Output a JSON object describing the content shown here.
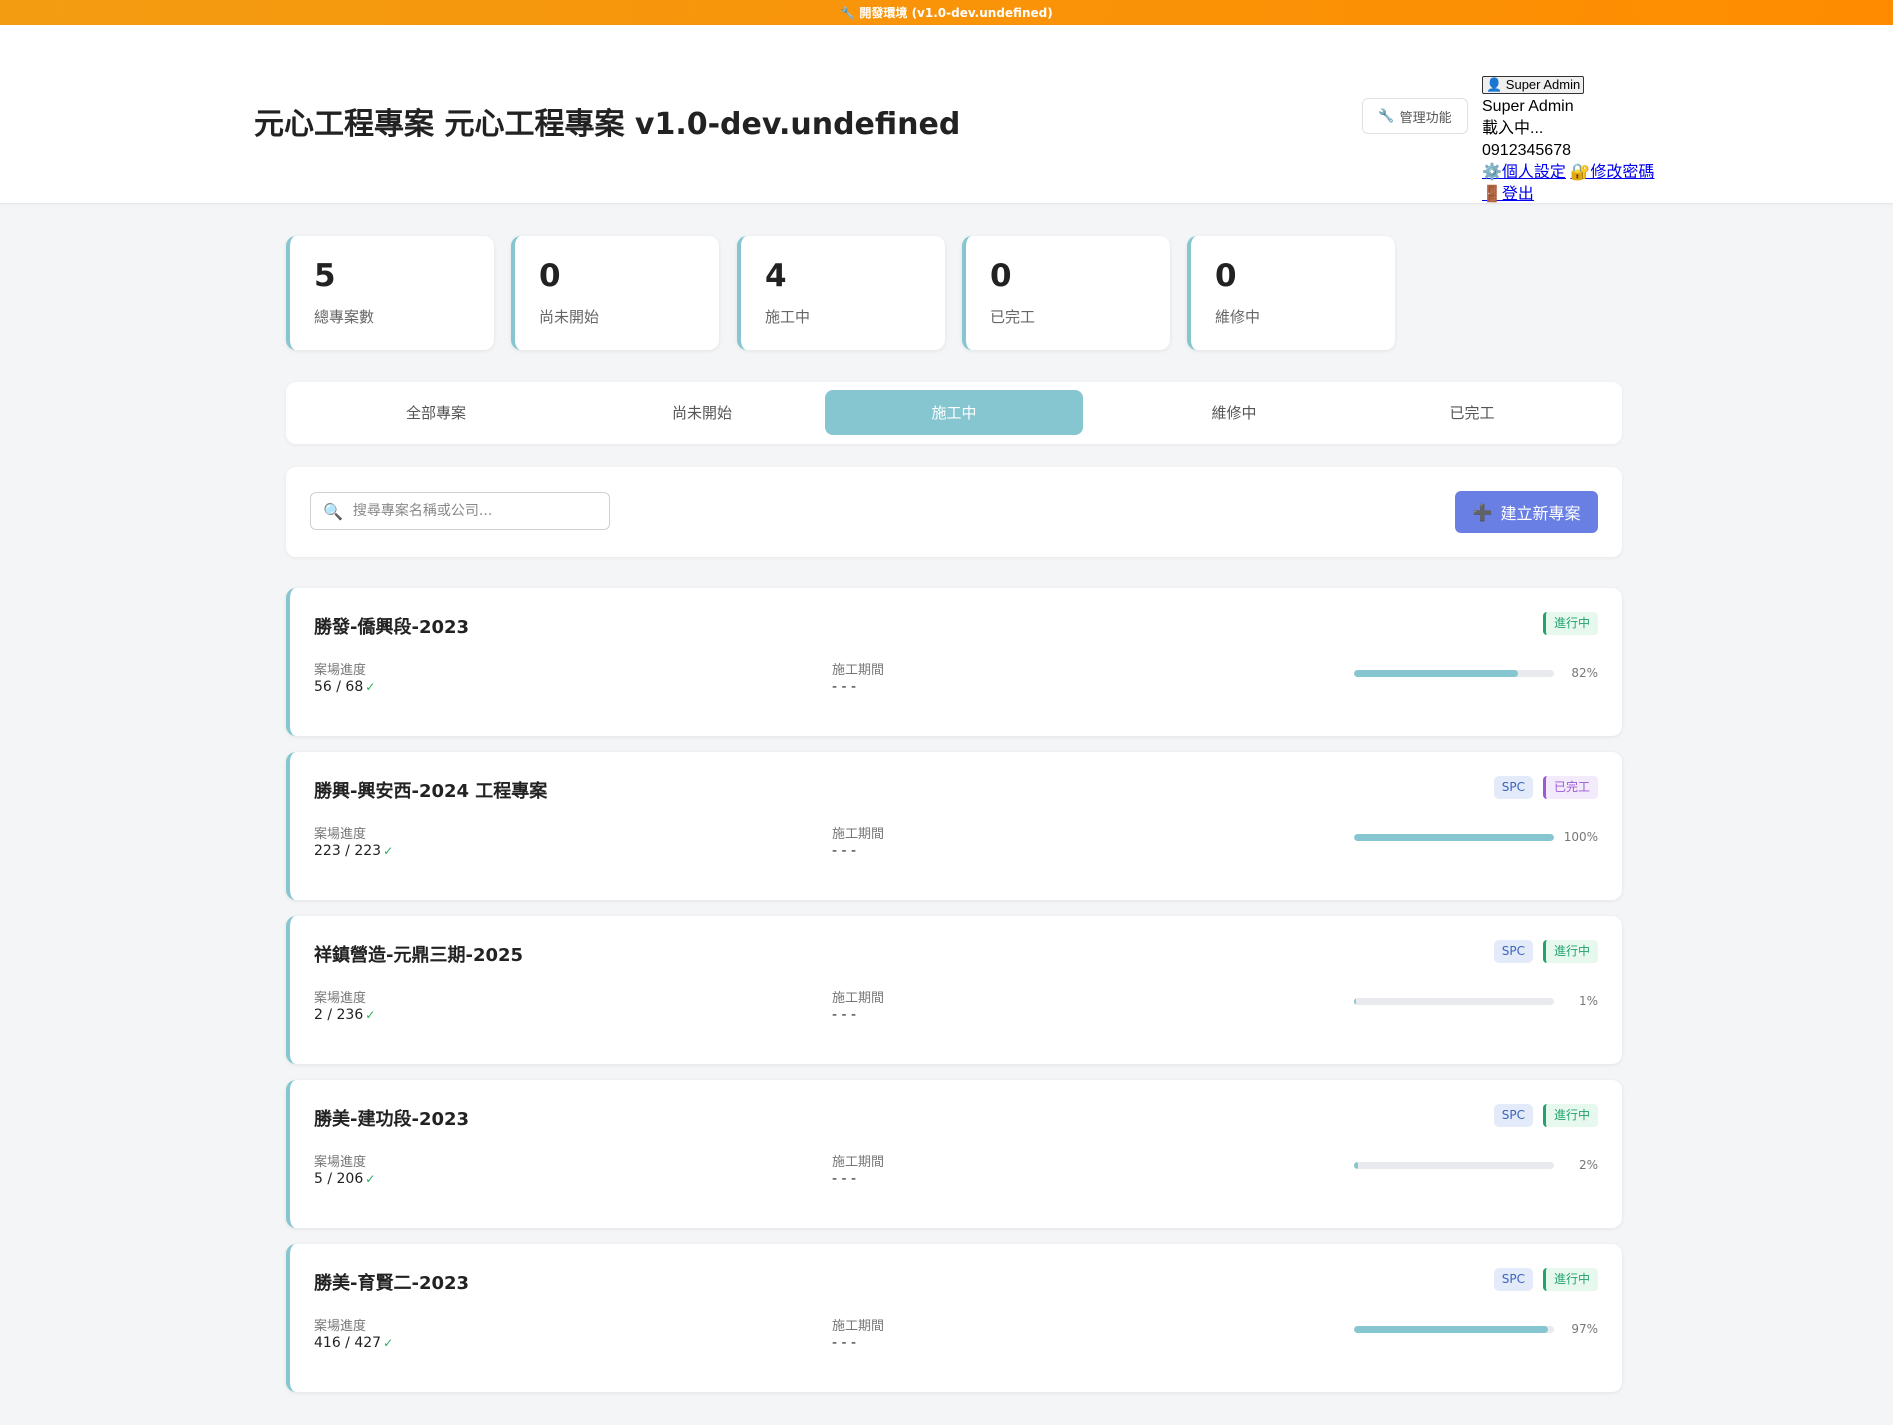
{
  "dev_banner": "🔧 開發環境 (v1.0-dev.undefined)",
  "header": {
    "title": "元心工程專案 元心工程專案 v1.0-dev.undefined",
    "admin_button": "管理功能",
    "user": {
      "chip": "👤 Super Admin",
      "name": "Super Admin",
      "status": "載入中...",
      "phone": "0912345678",
      "settings_link": "⚙️個人設定",
      "password_link": "🔐修改密碼",
      "logout_link": "🚪登出"
    }
  },
  "stats": [
    {
      "value": "5",
      "label": "總專案數"
    },
    {
      "value": "0",
      "label": "尚未開始"
    },
    {
      "value": "4",
      "label": "施工中"
    },
    {
      "value": "0",
      "label": "已完工"
    },
    {
      "value": "0",
      "label": "維修中"
    }
  ],
  "tabs": {
    "items": [
      "全部專案",
      "尚未開始",
      "施工中",
      "維修中",
      "已完工"
    ],
    "active": "施工中"
  },
  "toolbar": {
    "search_placeholder": "搜尋專案名稱或公司...",
    "create_button": "建立新專案"
  },
  "projects": [
    {
      "name": "勝發-僑興段-2023",
      "spc": "",
      "status": "進行中",
      "progress_label": "案場進度",
      "progress_value": "56 / 68",
      "period_label": "施工期間",
      "period_value": "- - -",
      "percent": 82,
      "percent_text": "82%"
    },
    {
      "name": "勝興-興安西-2024 工程專案",
      "spc": "SPC",
      "status": "已完工",
      "progress_label": "案場進度",
      "progress_value": "223 / 223",
      "period_label": "施工期間",
      "period_value": "- - -",
      "percent": 100,
      "percent_text": "100%"
    },
    {
      "name": "祥鎮營造-元鼎三期-2025",
      "spc": "SPC",
      "status": "進行中",
      "progress_label": "案場進度",
      "progress_value": "2 / 236",
      "period_label": "施工期間",
      "period_value": "- - -",
      "percent": 1,
      "percent_text": "1%"
    },
    {
      "name": "勝美-建功段-2023",
      "spc": "SPC",
      "status": "進行中",
      "progress_label": "案場進度",
      "progress_value": "5 / 206",
      "period_label": "施工期間",
      "period_value": "- - -",
      "percent": 2,
      "percent_text": "2%"
    },
    {
      "name": "勝美-育賢二-2023",
      "spc": "SPC",
      "status": "進行中",
      "progress_label": "案場進度",
      "progress_value": "416 / 427",
      "period_label": "施工期間",
      "period_value": "- - -",
      "percent": 97,
      "percent_text": "97%"
    }
  ],
  "colors": {
    "accent": "#85c6d0",
    "primary_button": "#6a7fe4",
    "status_in_progress": "#22a36b",
    "status_done": "#9b59d6",
    "dev_banner": "#ff8c00"
  }
}
